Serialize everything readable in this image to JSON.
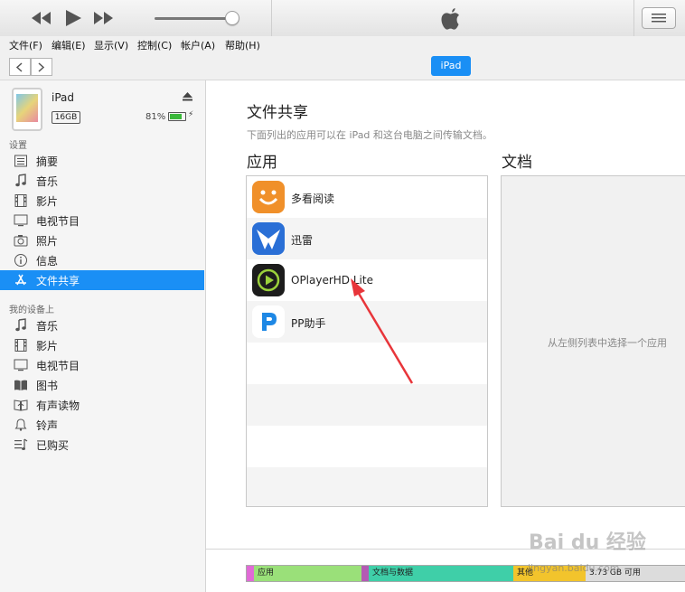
{
  "menu": [
    "文件(F)",
    "编辑(E)",
    "显示(V)",
    "控制(C)",
    "帐户(A)",
    "帮助(H)"
  ],
  "device": {
    "button": "iPad",
    "name": "iPad",
    "capacity": "16GB",
    "battery": "81%",
    "battery_level": 0.81
  },
  "sidebar": {
    "settings_title": "设置",
    "settings": [
      {
        "label": "摘要",
        "icon": "summary-icon"
      },
      {
        "label": "音乐",
        "icon": "music-note-icon"
      },
      {
        "label": "影片",
        "icon": "film-icon"
      },
      {
        "label": "电视节目",
        "icon": "tv-icon"
      },
      {
        "label": "照片",
        "icon": "camera-icon"
      },
      {
        "label": "信息",
        "icon": "info-icon"
      },
      {
        "label": "文件共享",
        "icon": "app-store-icon",
        "active": true
      }
    ],
    "ondevice_title": "我的设备上",
    "ondevice": [
      {
        "label": "音乐",
        "icon": "music-note-icon"
      },
      {
        "label": "影片",
        "icon": "film-icon"
      },
      {
        "label": "电视节目",
        "icon": "tv-icon"
      },
      {
        "label": "图书",
        "icon": "book-icon"
      },
      {
        "label": "有声读物",
        "icon": "audiobook-icon"
      },
      {
        "label": "铃声",
        "icon": "bell-icon"
      },
      {
        "label": "已购买",
        "icon": "purchased-icon"
      }
    ]
  },
  "main": {
    "title": "文件共享",
    "subtitle": "下面列出的应用可以在 iPad 和这台电脑之间传输文档。",
    "apps_title": "应用",
    "docs_title": "文档",
    "apps": [
      {
        "name": "多看阅读",
        "icon": "duokan-icon",
        "color": "#f0902a"
      },
      {
        "name": "迅雷",
        "icon": "xunlei-icon",
        "color": "#2a6fd6"
      },
      {
        "name": "OPlayerHD Lite",
        "icon": "oplayer-icon",
        "color": "#1c1c1c"
      },
      {
        "name": "PP助手",
        "icon": "pp-icon",
        "color": "#1e88e5"
      }
    ],
    "docs_hint": "从左侧列表中选择一个应用"
  },
  "storage": [
    {
      "label": "",
      "color": "#e06ad6",
      "fraction": 0.016
    },
    {
      "label": "应用",
      "color": "#9ae079",
      "fraction": 0.245
    },
    {
      "label": "",
      "color": "#b45ab4",
      "fraction": 0.016
    },
    {
      "label": "文档与数据",
      "color": "#3fcfa8",
      "fraction": 0.33
    },
    {
      "label": "其他",
      "color": "#f2c42c",
      "fraction": 0.165
    },
    {
      "label": "3.73 GB 可用",
      "color": "#dcdcdc",
      "fraction": 0.228
    }
  ],
  "watermark": {
    "brand": "Bai du 经验",
    "url": "jingyan.baidu.com"
  }
}
